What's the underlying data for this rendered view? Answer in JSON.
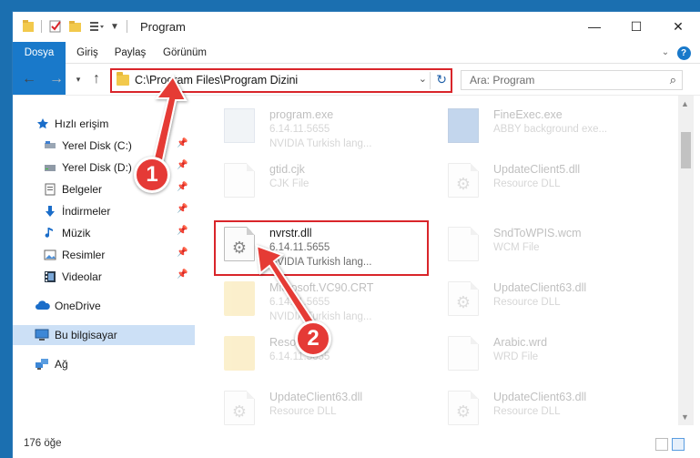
{
  "window": {
    "title": "Program",
    "minimize": "—",
    "maximize": "☐",
    "close": "✕"
  },
  "ribbon": {
    "tabs": [
      "Dosya",
      "Giriş",
      "Paylaş",
      "Görünüm"
    ],
    "help": "?"
  },
  "nav": {
    "address": "C:\\Program Files\\Program Dizini",
    "search_placeholder": "Ara: Program"
  },
  "sidebar": {
    "quick_access": "Hızlı erişim",
    "items": [
      {
        "label": "Yerel Disk (C:)"
      },
      {
        "label": "Yerel Disk (D:)"
      },
      {
        "label": "Belgeler"
      },
      {
        "label": "İndirmeler"
      },
      {
        "label": "Müzik"
      },
      {
        "label": "Resimler"
      },
      {
        "label": "Videolar"
      }
    ],
    "onedrive": "OneDrive",
    "this_pc": "Bu bilgisayar",
    "network": "Ağ"
  },
  "files": [
    {
      "name": "program.exe",
      "l2": "6.14.11.5655",
      "l3": "NVIDIA Turkish lang..."
    },
    {
      "name": "FineExec.exe",
      "l2": "ABBY background exe...",
      "l3": ""
    },
    {
      "name": "gtid.cjk",
      "l2": "CJK File",
      "l3": ""
    },
    {
      "name": "UpdateClient5.dll",
      "l2": "Resource DLL",
      "l3": ""
    },
    {
      "name": "nvrstr.dll",
      "l2": "6.14.11.5655",
      "l3": "NVIDIA Turkish lang..."
    },
    {
      "name": "SndToWPIS.wcm",
      "l2": "WCM File",
      "l3": ""
    },
    {
      "name": "Microsoft.VC90.CRT",
      "l2": "6.14.11.5655",
      "l3": "NVIDIA Turkish lang..."
    },
    {
      "name": "UpdateClient63.dll",
      "l2": "Resource DLL",
      "l3": ""
    },
    {
      "name": "Resources",
      "l2": "6.14.11.5655",
      "l3": ""
    },
    {
      "name": "Arabic.wrd",
      "l2": "WRD File",
      "l3": ""
    },
    {
      "name": "UpdateClient63.dll",
      "l2": "Resource DLL",
      "l3": ""
    },
    {
      "name": "UpdateClient63.dll",
      "l2": "Resource DLL",
      "l3": ""
    }
  ],
  "status": {
    "count": "176 öğe"
  },
  "annotations": {
    "step1": "1",
    "step2": "2"
  },
  "colors": {
    "accent": "#1979ca",
    "highlight": "#d9252a",
    "selection": "#cce0f6"
  }
}
